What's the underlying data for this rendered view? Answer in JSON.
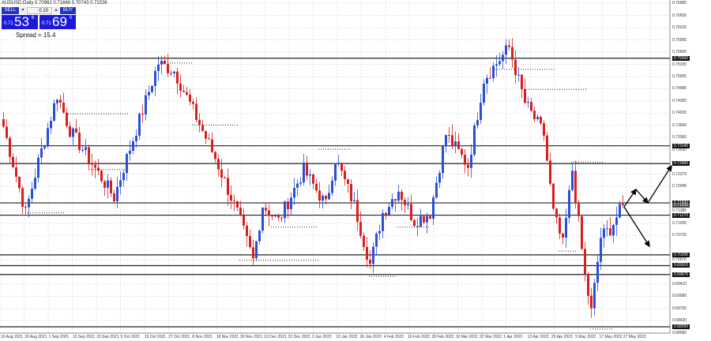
{
  "title": "AUDUSD,Daily  0.70962 0.71666 0.70743 0.71536",
  "trade_panel": {
    "sell_label": "SELL",
    "buy_label": "BUY",
    "minus": "▾",
    "plus": "▴",
    "lot": "0.10",
    "sell": {
      "prefix": "0.71",
      "big": "53",
      "sup": "6"
    },
    "buy": {
      "prefix": "0.71",
      "big": "69",
      "sup": "0"
    },
    "spread": "Spread = 15.4"
  },
  "colors": {
    "bull": "#2a4fd6",
    "bear": "#d62020",
    "grid": "#c8c8c8"
  },
  "y_axis": {
    "max": 0.76985,
    "min": 0.6809,
    "ticks": [
      "0.76985",
      "0.76655",
      "0.76325",
      "0.75995",
      "0.75665",
      "0.75335",
      "0.75005",
      "0.74680",
      "0.74350",
      "0.74020",
      "0.73690",
      "0.73360",
      "0.73030",
      "0.72375",
      "0.72045",
      "0.71385",
      "0.71055",
      "0.70725",
      "0.70070",
      "0.69410",
      "0.69080",
      "0.68750",
      "0.68420",
      "0.68090"
    ],
    "levels": [
      "0.75500",
      "0.73140",
      "0.72660",
      "0.71600",
      "0.71270",
      "0.70200",
      "0.69910",
      "0.69670",
      "0.68260"
    ],
    "current": "0.71536"
  },
  "x_axis": {
    "labels": [
      "10 Aug 2021",
      "20 Aug 2021",
      "1 Sep 2021",
      "13 Sep 2021",
      "23 Sep 2021",
      "5 Oct 2021",
      "15 Oct 2021",
      "27 Oct 2021",
      "8 Nov 2021",
      "18 Nov 2021",
      "30 Nov 2021",
      "10 Dec 2021",
      "22 Dec 2021",
      "3 Jan 2022",
      "13 Jan 2022",
      "26 Jan 2022",
      "4 Feb 2022",
      "16 Feb 2022",
      "28 Feb 2022",
      "10 Mar 2022",
      "22 Mar 2022",
      "1 Apr 2022",
      "13 Apr 2022",
      "25 Apr 2022",
      "5 May 2022",
      "17 May 2022",
      "27 May 2022"
    ]
  },
  "chart_data": {
    "type": "candlestick",
    "symbol": "AUDUSD",
    "timeframe": "Daily",
    "anchors": [
      [
        0,
        0.7366
      ],
      [
        7,
        0.7133
      ],
      [
        11,
        0.7271
      ],
      [
        17,
        0.7452
      ],
      [
        21,
        0.7356
      ],
      [
        26,
        0.7292
      ],
      [
        35,
        0.7175
      ],
      [
        39,
        0.7281
      ],
      [
        44,
        0.7409
      ],
      [
        49,
        0.7537
      ],
      [
        54,
        0.7516
      ],
      [
        60,
        0.7409
      ],
      [
        67,
        0.7281
      ],
      [
        74,
        0.7133
      ],
      [
        79,
        0.7005
      ],
      [
        82,
        0.7154
      ],
      [
        87,
        0.7111
      ],
      [
        95,
        0.7249
      ],
      [
        102,
        0.7154
      ],
      [
        105,
        0.7281
      ],
      [
        111,
        0.7154
      ],
      [
        116,
        0.6994
      ],
      [
        120,
        0.7133
      ],
      [
        125,
        0.7196
      ],
      [
        130,
        0.7111
      ],
      [
        135,
        0.7133
      ],
      [
        140,
        0.7345
      ],
      [
        147,
        0.726
      ],
      [
        152,
        0.7494
      ],
      [
        160,
        0.7579
      ],
      [
        165,
        0.743
      ],
      [
        171,
        0.7345
      ],
      [
        174,
        0.7133
      ],
      [
        177,
        0.7047
      ],
      [
        180,
        0.7249
      ],
      [
        184,
        0.6962
      ],
      [
        186,
        0.6866
      ],
      [
        189,
        0.7068
      ],
      [
        192,
        0.709
      ],
      [
        196,
        0.71536
      ]
    ]
  }
}
